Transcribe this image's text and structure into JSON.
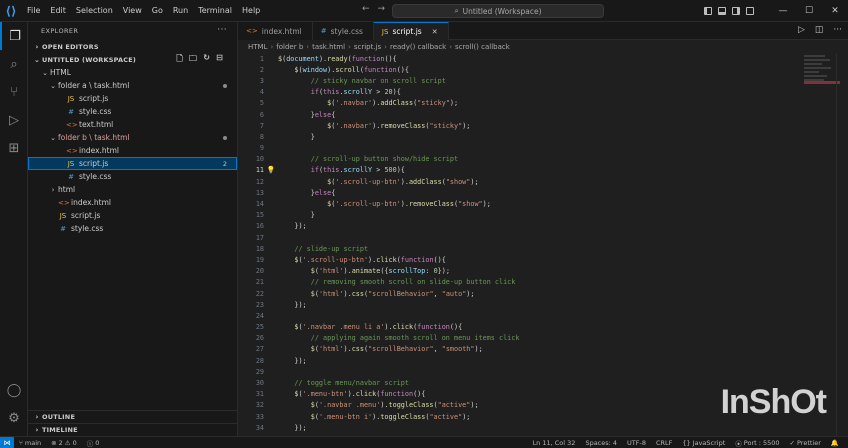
{
  "titlebar": {
    "menu": [
      "File",
      "Edit",
      "Selection",
      "View",
      "Go",
      "Run",
      "Terminal",
      "Help"
    ],
    "search_text": "Untitled (Workspace)"
  },
  "sidebar": {
    "title": "EXPLORER",
    "open_editors": "OPEN EDITORS",
    "workspace": "UNTITLED (WORKSPACE)",
    "tree": [
      {
        "label": "HTML",
        "kind": "folder",
        "indent": 1
      },
      {
        "label": "folder a \\ task.html",
        "kind": "folder",
        "indent": 2
      },
      {
        "label": "script.js",
        "kind": "js",
        "indent": 3
      },
      {
        "label": "style.css",
        "kind": "css",
        "indent": 3
      },
      {
        "label": "text.html",
        "kind": "html",
        "indent": 3
      },
      {
        "label": "folder b \\ task.html",
        "kind": "folder-b",
        "indent": 2
      },
      {
        "label": "index.html",
        "kind": "html",
        "indent": 3
      },
      {
        "label": "script.js",
        "kind": "js",
        "indent": 3,
        "selected": true,
        "badge": "2"
      },
      {
        "label": "style.css",
        "kind": "css",
        "indent": 3
      },
      {
        "label": "html",
        "kind": "folder",
        "indent": 2
      },
      {
        "label": "index.html",
        "kind": "html",
        "indent": 2
      },
      {
        "label": "script.js",
        "kind": "js",
        "indent": 2
      },
      {
        "label": "style.css",
        "kind": "css",
        "indent": 2
      }
    ],
    "outline": "OUTLINE",
    "timeline": "TIMELINE"
  },
  "tabs": [
    {
      "label": "index.html",
      "kind": "html"
    },
    {
      "label": "style.css",
      "kind": "css"
    },
    {
      "label": "script.js",
      "kind": "js",
      "active": true
    }
  ],
  "breadcrumb": [
    "HTML",
    "folder b",
    "task.html",
    "script.js",
    "ready() callback",
    "scroll() callback"
  ],
  "code_lines": [
    {
      "n": "1",
      "t": "$(document).ready(function(){"
    },
    {
      "n": "2",
      "t": "    $(window).scroll(function(){"
    },
    {
      "n": "3",
      "t": "        // sticky navbar on scroll script"
    },
    {
      "n": "4",
      "t": "        if(this.scrollY > 20){"
    },
    {
      "n": "5",
      "t": "            $('.navbar').addClass(\"sticky\");"
    },
    {
      "n": "6",
      "t": "        }else{"
    },
    {
      "n": "7",
      "t": "            $('.navbar').removeClass(\"sticky\");"
    },
    {
      "n": "8",
      "t": "        }"
    },
    {
      "n": "9",
      "t": ""
    },
    {
      "n": "10",
      "t": "        // scroll-up button show/hide script"
    },
    {
      "n": "11",
      "t": "        if(this.scrollY > 500){"
    },
    {
      "n": "12",
      "t": "            $('.scroll-up-btn').addClass(\"show\");"
    },
    {
      "n": "13",
      "t": "        }else{"
    },
    {
      "n": "14",
      "t": "            $('.scroll-up-btn').removeClass(\"show\");"
    },
    {
      "n": "15",
      "t": "        }"
    },
    {
      "n": "16",
      "t": "    });"
    },
    {
      "n": "17",
      "t": ""
    },
    {
      "n": "18",
      "t": "    // slide-up script"
    },
    {
      "n": "19",
      "t": "    $('.scroll-up-btn').click(function(){"
    },
    {
      "n": "20",
      "t": "        $('html').animate({scrollTop: 0});"
    },
    {
      "n": "21",
      "t": "        // removing smooth scroll on slide-up button click"
    },
    {
      "n": "22",
      "t": "        $('html').css(\"scrollBehavior\", \"auto\");"
    },
    {
      "n": "23",
      "t": "    });"
    },
    {
      "n": "24",
      "t": ""
    },
    {
      "n": "25",
      "t": "    $('.navbar .menu li a').click(function(){"
    },
    {
      "n": "26",
      "t": "        // applying again smooth scroll on menu items click"
    },
    {
      "n": "27",
      "t": "        $('html').css(\"scrollBehavior\", \"smooth\");"
    },
    {
      "n": "28",
      "t": "    });"
    },
    {
      "n": "29",
      "t": ""
    },
    {
      "n": "30",
      "t": "    // toggle menu/navbar script"
    },
    {
      "n": "31",
      "t": "    $('.menu-btn').click(function(){"
    },
    {
      "n": "32",
      "t": "        $('.navbar .menu').toggleClass(\"active\");"
    },
    {
      "n": "33",
      "t": "        $('.menu-btn i').toggleClass(\"active\");"
    },
    {
      "n": "34",
      "t": "    });"
    }
  ],
  "current_line": "11",
  "watermark": "InShOt",
  "status": {
    "branch": "main",
    "errors": "2",
    "warnings": "0",
    "info": "0",
    "cursor": "Ln 11, Col 32",
    "spaces": "Spaces: 4",
    "encoding": "UTF-8",
    "eol": "CRLF",
    "language": "JavaScript",
    "port": "Port : 5500",
    "prettier": "Prettier"
  }
}
